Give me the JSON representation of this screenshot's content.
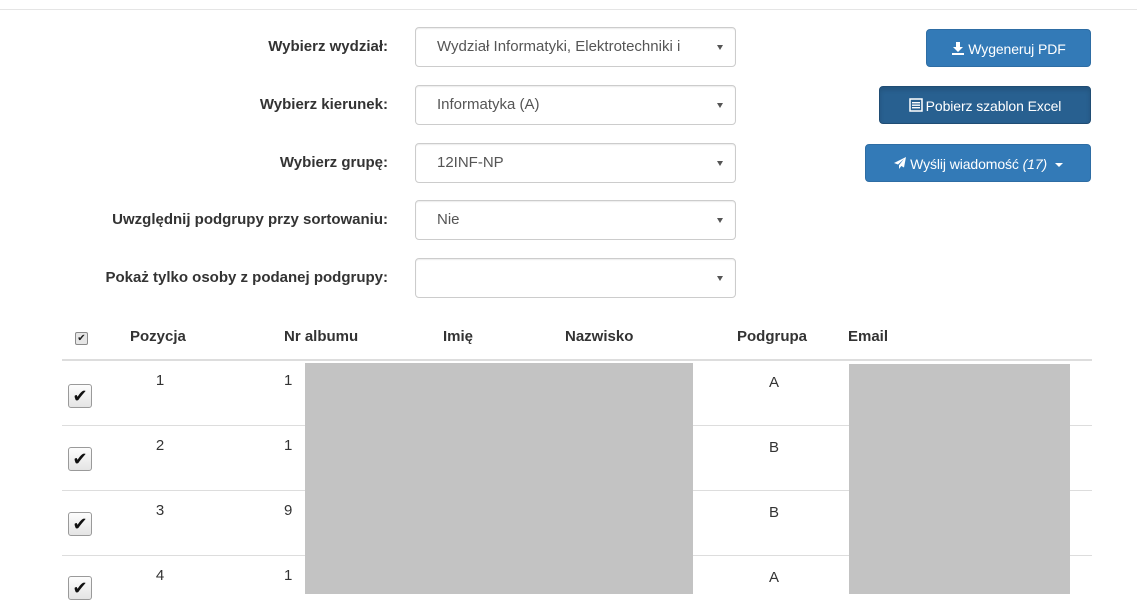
{
  "form": {
    "faculty": {
      "label": "Wybierz wydział:",
      "value": "Wydział Informatyki, Elektrotechniki i"
    },
    "direction": {
      "label": "Wybierz kierunek:",
      "value": "Informatyka (A)"
    },
    "group": {
      "label": "Wybierz grupę:",
      "value": "12INF-NP"
    },
    "subgroup_sort": {
      "label": "Uwzględnij podgrupy przy sortowaniu:",
      "value": "Nie"
    },
    "subgroup_filter": {
      "label": "Pokaż tylko osoby z podanej podgrupy:",
      "value": ""
    }
  },
  "buttons": {
    "pdf": {
      "icon": "download-icon",
      "label": "Wygeneruj PDF"
    },
    "excel": {
      "icon": "list-icon",
      "label": "Pobierz szablon Excel"
    },
    "message": {
      "icon": "send-icon",
      "label": "Wyślij wiadomość",
      "count": "(17)"
    }
  },
  "table": {
    "headers": {
      "position": "Pozycja",
      "album": "Nr albumu",
      "first_name": "Imię",
      "last_name": "Nazwisko",
      "subgroup": "Podgrupa",
      "email": "Email"
    },
    "rows": [
      {
        "position": "1",
        "album": "1",
        "subgroup": "A",
        "checked": true
      },
      {
        "position": "2",
        "album": "1",
        "subgroup": "B",
        "checked": true
      },
      {
        "position": "3",
        "album": "9",
        "subgroup": "B",
        "checked": true
      },
      {
        "position": "4",
        "album": "1",
        "subgroup": "A",
        "checked": true
      }
    ]
  },
  "colors": {
    "primary": "#337ab7",
    "primary_active": "#286090",
    "redaction": "#c3c3c3"
  }
}
